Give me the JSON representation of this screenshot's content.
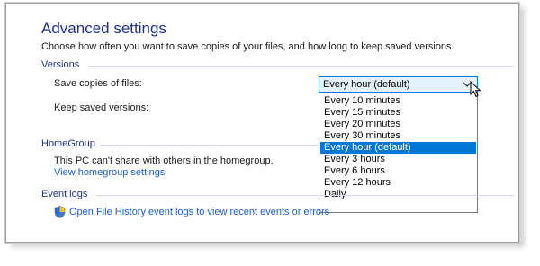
{
  "header": {
    "title": "Advanced settings",
    "description": "Choose how often you want to save copies of your files, and how long to keep saved versions."
  },
  "versions": {
    "section_label": "Versions",
    "save_copies_label": "Save copies of files:",
    "keep_versions_label": "Keep saved versions:",
    "save_copies_dropdown": {
      "selected_value": "Every hour (default)",
      "options": [
        "Every 10 minutes",
        "Every 15 minutes",
        "Every 20 minutes",
        "Every 30 minutes",
        "Every hour (default)",
        "Every 3 hours",
        "Every 6 hours",
        "Every 12 hours",
        "Daily"
      ],
      "highlighted_option": "Every hour (default)"
    }
  },
  "homegroup": {
    "section_label": "HomeGroup",
    "status_text": "This PC can't share with others in the homegroup.",
    "settings_link": "View homegroup settings"
  },
  "event_logs": {
    "section_label": "Event logs",
    "open_link": "Open File History event logs to view recent events or errors"
  },
  "colors": {
    "heading": "#1e3287",
    "link": "#1a5ec9",
    "selection": "#0078d7"
  },
  "icons": {
    "dropdown_arrow": "chevron-down-icon",
    "event_log_icon": "shield-icon",
    "pointer": "mouse-pointer-icon"
  }
}
